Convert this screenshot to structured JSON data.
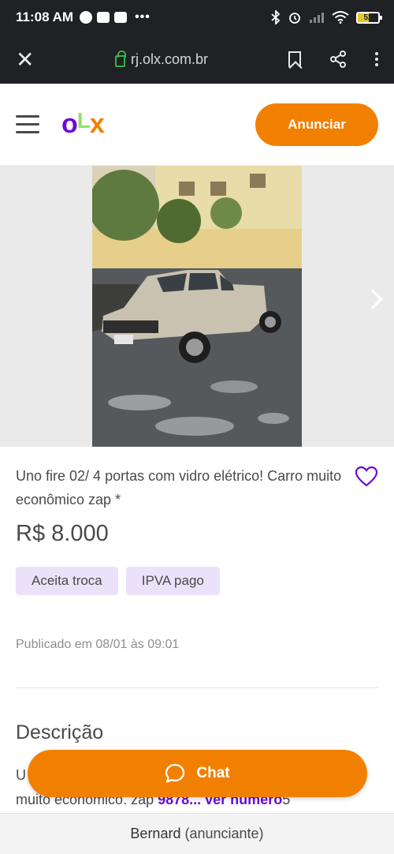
{
  "status_bar": {
    "time": "11:08 AM",
    "dots": "•••",
    "battery": "52"
  },
  "browser": {
    "url": "rj.olx.com.br"
  },
  "header": {
    "logo": {
      "o": "o",
      "l": "L",
      "x": "x"
    },
    "cta_label": "Anunciar"
  },
  "listing": {
    "title": "Uno fire 02/ 4 portas com vidro elétrico! Carro muito econômico zap *",
    "price": "R$ 8.000",
    "tags": [
      "Aceita troca",
      "IPVA pago"
    ],
    "published": "Publicado em 08/01 às 09:01",
    "description_title": "Descrição",
    "description_line1": "U",
    "description_line2_text": "muito econômico. zap ",
    "description_phone": "9878...",
    "description_more": "ver número",
    "description_tail": "5"
  },
  "chat": {
    "label": "Chat"
  },
  "footer": {
    "seller_name": "Bernard",
    "seller_role": "(anunciante)"
  },
  "colors": {
    "accent_orange": "#f28000",
    "brand_purple": "#6e0ad6",
    "brand_green": "#8ce563",
    "chip_bg": "#ebe2f9",
    "status_bar_bg": "#1f2125"
  }
}
